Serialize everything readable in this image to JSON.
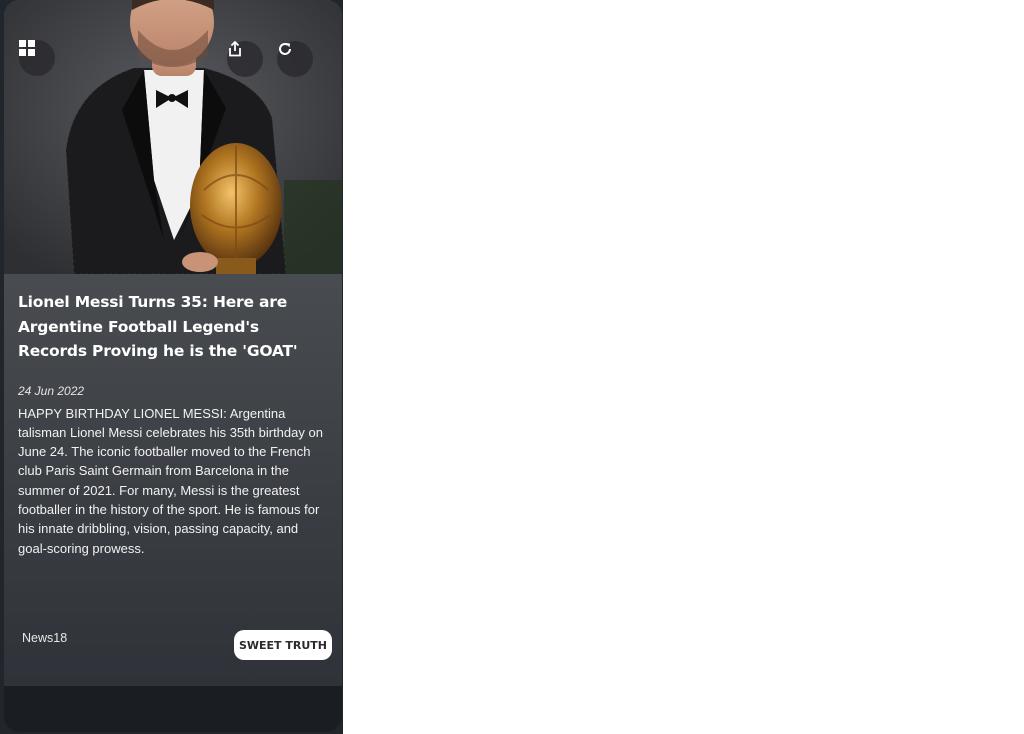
{
  "toolbar": {
    "grid_icon": "grid-icon",
    "share_icon": "share-icon",
    "refresh_icon": "refresh-icon"
  },
  "article": {
    "headline": "Lionel Messi Turns 35: Here are Argentine Football Legend's Records Proving he is the 'GOAT'",
    "date": "24 Jun 2022",
    "body": "HAPPY BIRTHDAY LIONEL MESSI: Argentina talisman Lionel Messi celebrates his 35th birthday on June 24. The iconic footballer moved to the French club Paris Saint Germain from Barcelona in the summer of 2021. For many, Messi is the greatest footballer in the history of the sport. He is famous for his innate dribbling, vision, passing capacity, and goal-scoring prowess.",
    "source": "News18",
    "action_label": "SWEET TRUTH"
  },
  "colors": {
    "card_top": "#5b5d61",
    "card_bottom": "#2c3036",
    "button_bg": "#ffffff",
    "text": "#ffffff"
  }
}
